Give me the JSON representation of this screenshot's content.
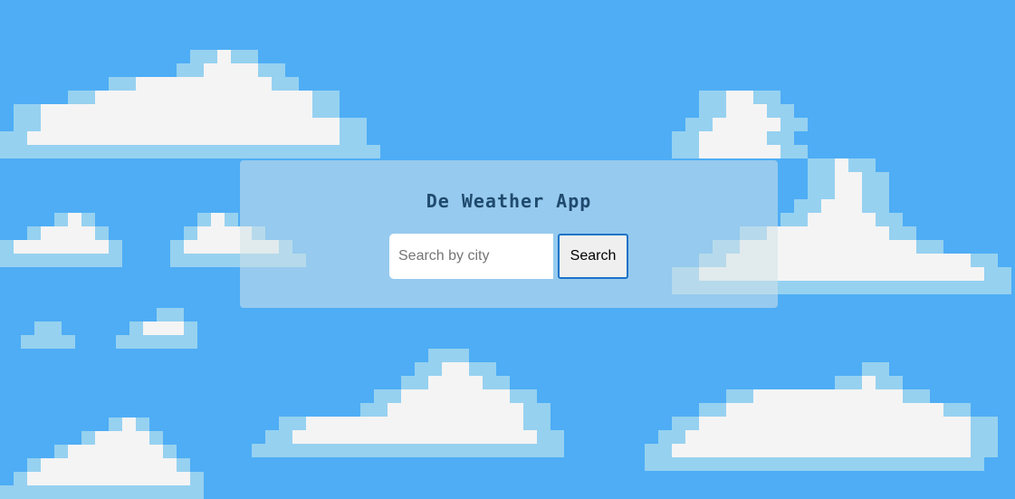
{
  "app": {
    "title": "De Weather App"
  },
  "search": {
    "placeholder": "Search by city",
    "value": "",
    "button_label": "Search"
  },
  "colors": {
    "sky": "#4eadf5",
    "cloud_white": "#f4f4f4",
    "cloud_shade": "#96d1f0",
    "title_text": "#1f4a6e",
    "button_border": "#1a73c8"
  }
}
